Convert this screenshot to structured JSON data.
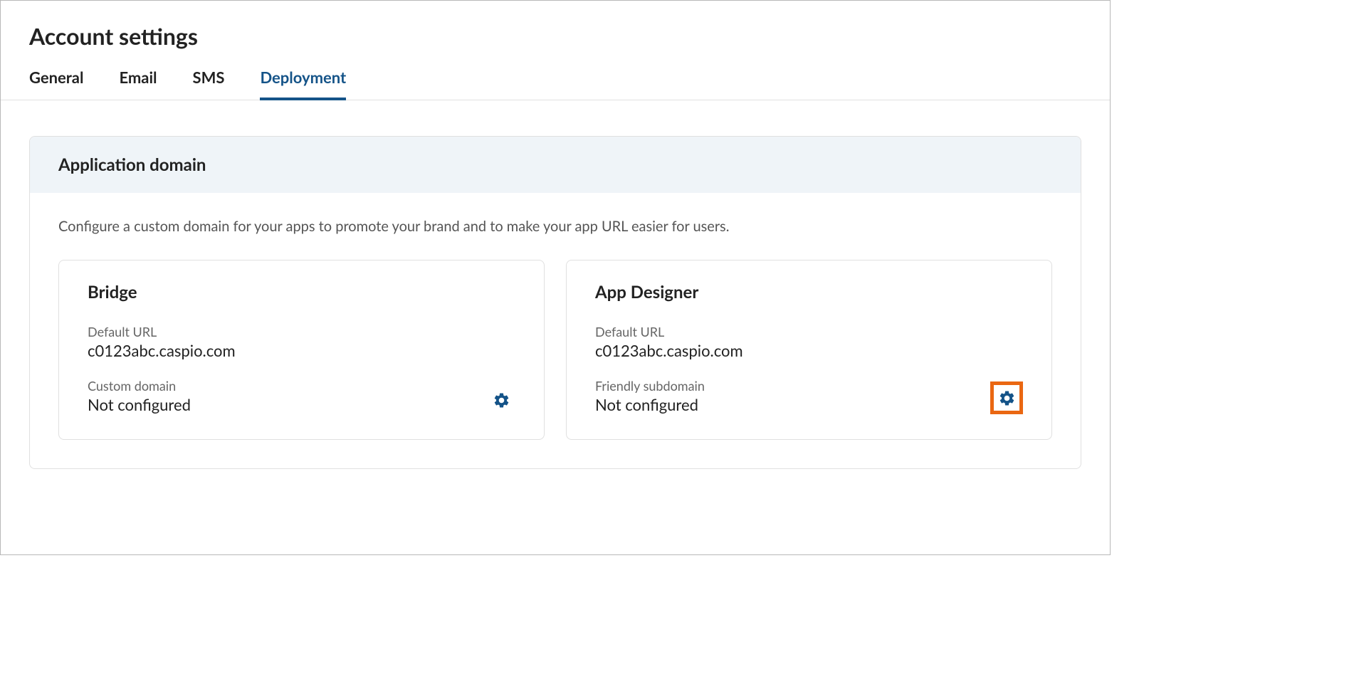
{
  "page": {
    "title": "Account settings"
  },
  "tabs": [
    {
      "label": "General",
      "active": false
    },
    {
      "label": "Email",
      "active": false
    },
    {
      "label": "SMS",
      "active": false
    },
    {
      "label": "Deployment",
      "active": true
    }
  ],
  "section": {
    "title": "Application domain",
    "description": "Configure a custom domain for your apps to promote your brand and to make your app URL easier for users."
  },
  "cards": [
    {
      "title": "Bridge",
      "default_url_label": "Default URL",
      "default_url_value": "c0123abc.caspio.com",
      "domain_label": "Custom domain",
      "domain_value": "Not configured",
      "highlighted": false
    },
    {
      "title": "App Designer",
      "default_url_label": "Default URL",
      "default_url_value": "c0123abc.caspio.com",
      "domain_label": "Friendly subdomain",
      "domain_value": "Not configured",
      "highlighted": true
    }
  ]
}
